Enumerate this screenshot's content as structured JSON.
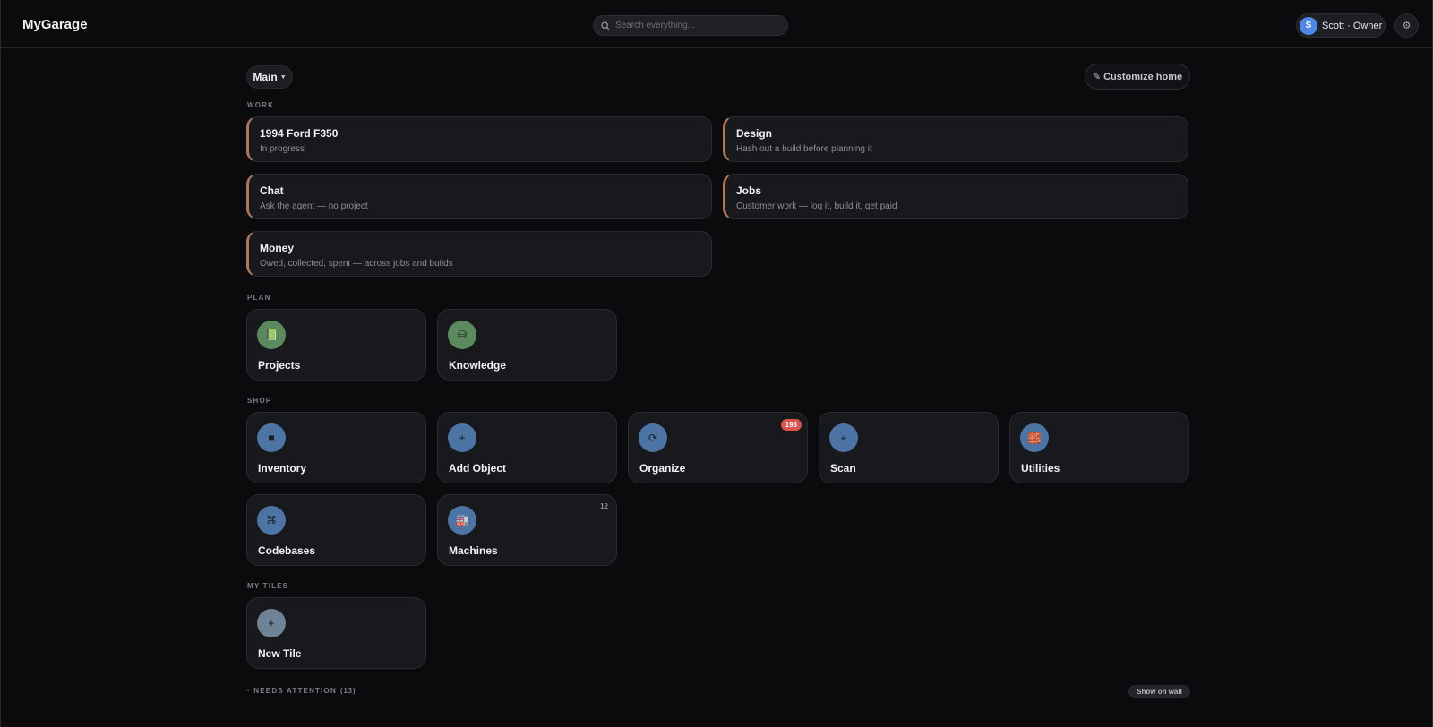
{
  "app": {
    "title": "MyGarage"
  },
  "search": {
    "placeholder": "Search everything..."
  },
  "user": {
    "initial": "S",
    "label": "Scott · Owner"
  },
  "settings": {
    "icon": "gear-icon",
    "glyph": "⚙"
  },
  "home": {
    "dropdown_label": "Main",
    "customize_label": "✎ Customize home"
  },
  "sections": {
    "work": {
      "label": "WORK",
      "cards": [
        {
          "title": "1994 Ford F350",
          "subtitle": "In progress"
        },
        {
          "title": "Design",
          "subtitle": "Hash out a build before planning it"
        },
        {
          "title": "Chat",
          "subtitle": "Ask the agent — no project"
        },
        {
          "title": "Jobs",
          "subtitle": "Customer work — log it, build it, get paid"
        },
        {
          "title": "Money",
          "subtitle": "Owed, collected, spent — across jobs and builds"
        }
      ]
    },
    "plan": {
      "label": "PLAN",
      "tiles": [
        {
          "label": "Projects",
          "icon": "notebook-icon",
          "glyph": "📗"
        },
        {
          "label": "Knowledge",
          "icon": "database-icon",
          "glyph": "⛁"
        }
      ]
    },
    "shop": {
      "label": "SHOP",
      "tiles": [
        {
          "label": "Inventory",
          "icon": "box-icon",
          "glyph": "■"
        },
        {
          "label": "Add Object",
          "icon": "plus-icon",
          "glyph": "+"
        },
        {
          "label": "Organize",
          "icon": "refresh-icon",
          "glyph": "⟳",
          "badge": "193"
        },
        {
          "label": "Scan",
          "icon": "crosshair-icon",
          "glyph": "⌖"
        },
        {
          "label": "Utilities",
          "icon": "brick-icon",
          "glyph": "🧱"
        },
        {
          "label": "Codebases",
          "icon": "command-icon",
          "glyph": "⌘"
        },
        {
          "label": "Machines",
          "icon": "factory-icon",
          "glyph": "🏭",
          "badge": "12"
        }
      ]
    },
    "my_tiles": {
      "label": "MY TILES",
      "tiles": [
        {
          "label": "New Tile",
          "icon": "plus-icon",
          "glyph": "+"
        }
      ]
    }
  },
  "attention": {
    "label": "· NEEDS ATTENTION",
    "count": "(13)",
    "button": "Show on wall"
  },
  "colors": {
    "accent_border": "#b07654",
    "badge_red": "#d9534f",
    "avatar": "#4f87e6"
  }
}
